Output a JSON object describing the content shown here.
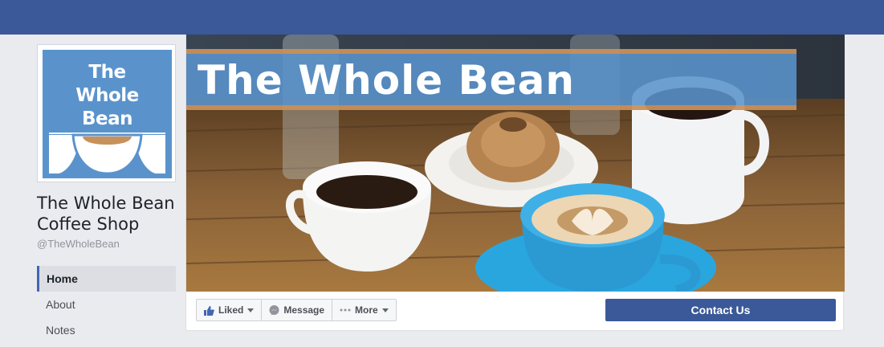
{
  "page": {
    "logo_lines": [
      "The",
      "Whole",
      "Bean"
    ],
    "name_line1": "The Whole Bean",
    "name_line2": "Coffee Shop",
    "handle": "@TheWholeBean"
  },
  "cover": {
    "title": "The Whole Bean"
  },
  "nav": {
    "items": [
      {
        "label": "Home",
        "active": true
      },
      {
        "label": "About",
        "active": false
      },
      {
        "label": "Notes",
        "active": false
      }
    ]
  },
  "actions": {
    "liked_label": "Liked",
    "message_label": "Message",
    "more_label": "More",
    "contact_label": "Contact Us"
  },
  "icons": {
    "liked": "thumbs-up-icon",
    "message": "messenger-icon",
    "more": "ellipsis-icon",
    "dropdown": "caret-down-icon"
  },
  "colors": {
    "brand_blue": "#3b5998",
    "logo_blue": "#5a93cc",
    "banner_orange": "#c8905a"
  }
}
